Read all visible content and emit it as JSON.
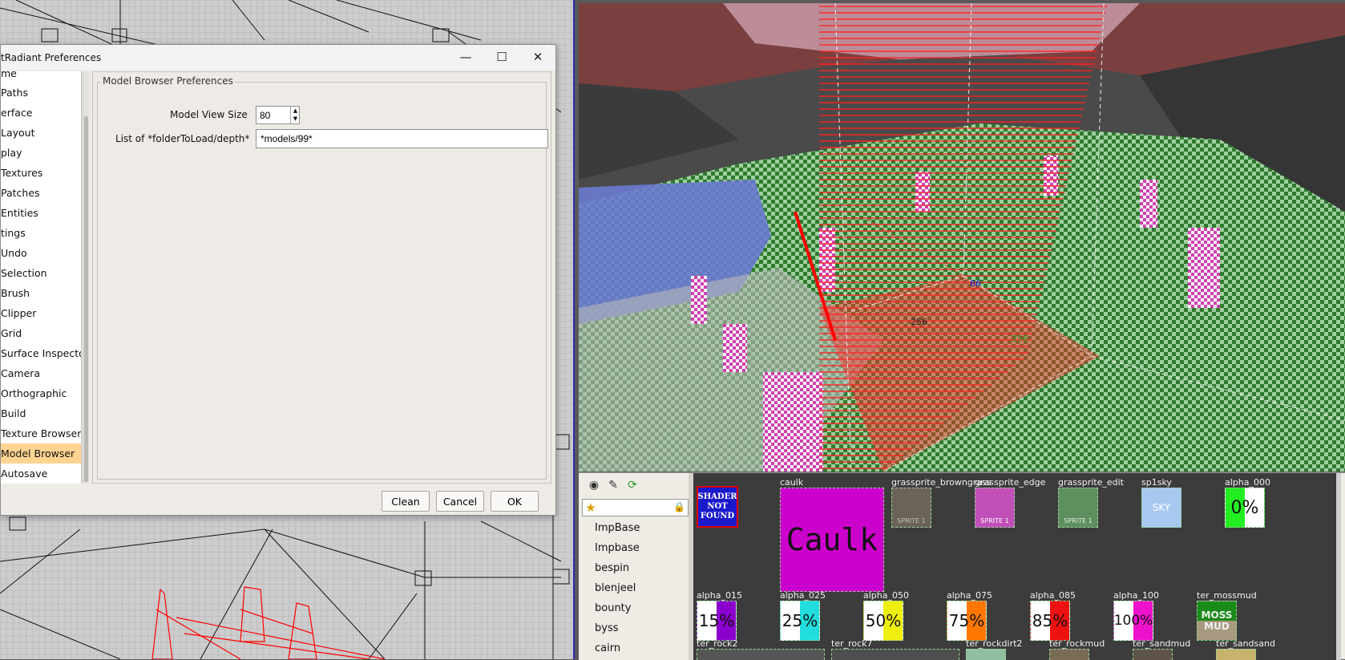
{
  "dialog": {
    "title": "tRadiant Preferences",
    "minimize": "—",
    "maximize": "☐",
    "close": "✕",
    "sidebar_items": [
      {
        "label": "me"
      },
      {
        "label": "Paths"
      },
      {
        "label": "erface"
      },
      {
        "label": "Layout"
      },
      {
        "label": "play"
      },
      {
        "label": "Textures"
      },
      {
        "label": "Patches"
      },
      {
        "label": "Entities"
      },
      {
        "label": "tings"
      },
      {
        "label": "Undo"
      },
      {
        "label": "Selection"
      },
      {
        "label": "Brush"
      },
      {
        "label": "Clipper"
      },
      {
        "label": "Grid"
      },
      {
        "label": "Surface Inspector"
      },
      {
        "label": "Camera"
      },
      {
        "label": "Orthographic"
      },
      {
        "label": "Build"
      },
      {
        "label": "Texture Browser"
      },
      {
        "label": "Model Browser"
      },
      {
        "label": "Autosave"
      }
    ],
    "active_item": "Model Browser",
    "group_title": "Model Browser Preferences",
    "model_view_size_label": "Model View Size",
    "model_view_size_value": "80",
    "list_label": "List of *folderToLoad/depth*",
    "list_value": "*models/99*",
    "clean_label": "Clean",
    "cancel_label": "Cancel",
    "ok_label": "OK"
  },
  "camera": {
    "measure_labels": [
      "256",
      "256",
      "66"
    ]
  },
  "texture_browser": {
    "tree_items": [
      "ImpBase",
      "Impbase",
      "bespin",
      "blenjeel",
      "bounty",
      "byss",
      "cairn"
    ],
    "textures_row1": [
      {
        "name": "",
        "thumb_text": "SHADER NOT FOUND"
      },
      {
        "name": "caulk",
        "thumb_text": "Caulk"
      },
      {
        "name": "grassprite_browngrass",
        "thumb_text": "SPRITE 1"
      },
      {
        "name": "grassprite_edge",
        "thumb_text": "SPRITE 1"
      },
      {
        "name": "grassprite_edit",
        "thumb_text": "SPRITE 1"
      },
      {
        "name": "sp1sky",
        "thumb_text": "SKY"
      },
      {
        "name": "alpha_000",
        "thumb_text": "0%"
      }
    ],
    "textures_row2": [
      {
        "name": "alpha_015",
        "thumb_text": "15%"
      },
      {
        "name": "alpha_025",
        "thumb_text": "25%"
      },
      {
        "name": "alpha_050",
        "thumb_text": "50%"
      },
      {
        "name": "alpha_075",
        "thumb_text": "75%"
      },
      {
        "name": "alpha_085",
        "thumb_text": "85%"
      },
      {
        "name": "alpha_100",
        "thumb_text": "100%"
      },
      {
        "name": "ter_mossmud",
        "thumb_text": "MOSS MUD"
      }
    ],
    "textures_row3": [
      {
        "name": "ter_rock2"
      },
      {
        "name": "ter_rock7"
      },
      {
        "name": "ter_rockdirt2"
      },
      {
        "name": "ter_rockmud"
      },
      {
        "name": "ter_sandmud"
      },
      {
        "name": "ter_sandsand"
      }
    ],
    "colors": {
      "shader_not_found_bg": "#1a1acc",
      "caulk_bg": "#cc00cc",
      "sky_bg": "#a8c8f0"
    }
  }
}
